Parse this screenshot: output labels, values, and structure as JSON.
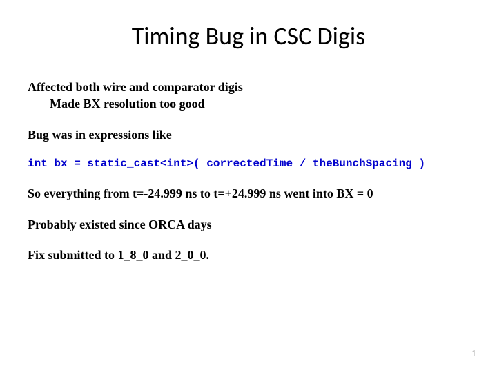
{
  "title": "Timing Bug in CSC Digis",
  "lines": {
    "affected": "Affected both wire and comparator digis",
    "made_bx": "Made BX resolution too good",
    "bug_was": "Bug was in expressions like",
    "code": "int bx = static_cast<int>( correctedTime / theBunchSpacing )",
    "so_everything": "So everything from t=-24.999 ns to t=+24.999 ns went into BX = 0",
    "probably": "Probably existed since ORCA days",
    "fix": "Fix submitted to 1_8_0 and 2_0_0."
  },
  "page_number": "1"
}
